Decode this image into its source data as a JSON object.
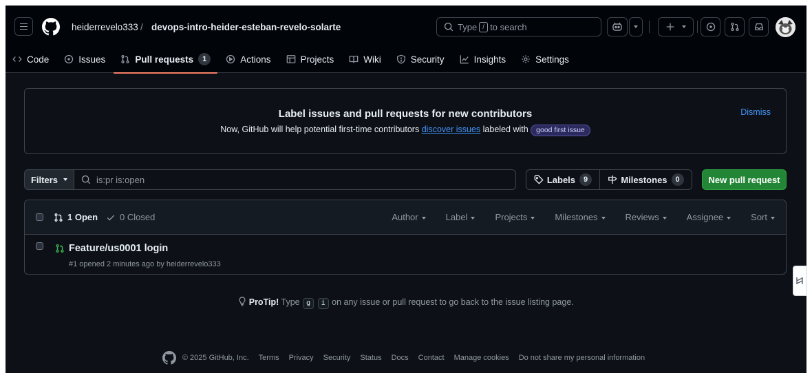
{
  "header": {
    "owner": "heiderrevelo333",
    "separator": "/",
    "repo": "devops-intro-heider-esteban-revelo-solarte",
    "search_prefix": "Type",
    "search_key": "/",
    "search_suffix": "to search"
  },
  "nav": {
    "tabs": [
      {
        "label": "Code",
        "icon": "code-icon"
      },
      {
        "label": "Issues",
        "icon": "issue-icon"
      },
      {
        "label": "Pull requests",
        "icon": "git-pull-request-icon",
        "count": "1",
        "active": true
      },
      {
        "label": "Actions",
        "icon": "play-icon"
      },
      {
        "label": "Projects",
        "icon": "table-icon"
      },
      {
        "label": "Wiki",
        "icon": "book-icon"
      },
      {
        "label": "Security",
        "icon": "shield-icon"
      },
      {
        "label": "Insights",
        "icon": "graph-icon"
      },
      {
        "label": "Settings",
        "icon": "gear-icon"
      }
    ]
  },
  "banner": {
    "title": "Label issues and pull requests for new contributors",
    "text_before": "Now, GitHub will help potential first-time contributors",
    "link": "discover issues",
    "text_after": "labeled with",
    "label": "good first issue",
    "dismiss": "Dismiss"
  },
  "filters": {
    "button": "Filters",
    "query": "is:pr is:open",
    "labels": "Labels",
    "labels_count": "9",
    "milestones": "Milestones",
    "milestones_count": "0",
    "new_pr": "New pull request"
  },
  "list": {
    "open": "1 Open",
    "closed": "0 Closed",
    "sort_menus": [
      "Author",
      "Label",
      "Projects",
      "Milestones",
      "Reviews",
      "Assignee",
      "Sort"
    ],
    "items": [
      {
        "title": "Feature/us0001 login",
        "meta": "#1 opened 2 minutes ago by heiderrevelo333"
      }
    ]
  },
  "protip": {
    "label": "ProTip!",
    "before": "Type",
    "key1": "g",
    "key2": "i",
    "after": "on any issue or pull request to go back to the issue listing page."
  },
  "footer": {
    "copyright": "© 2025 GitHub, Inc.",
    "links": [
      "Terms",
      "Privacy",
      "Security",
      "Status",
      "Docs",
      "Contact",
      "Manage cookies",
      "Do not share my personal information"
    ]
  },
  "colors": {
    "background": "#0d1117",
    "accent_tab": "#f78166",
    "primary_button": "#238636",
    "link": "#4493f8",
    "open_icon": "#3fb950"
  }
}
